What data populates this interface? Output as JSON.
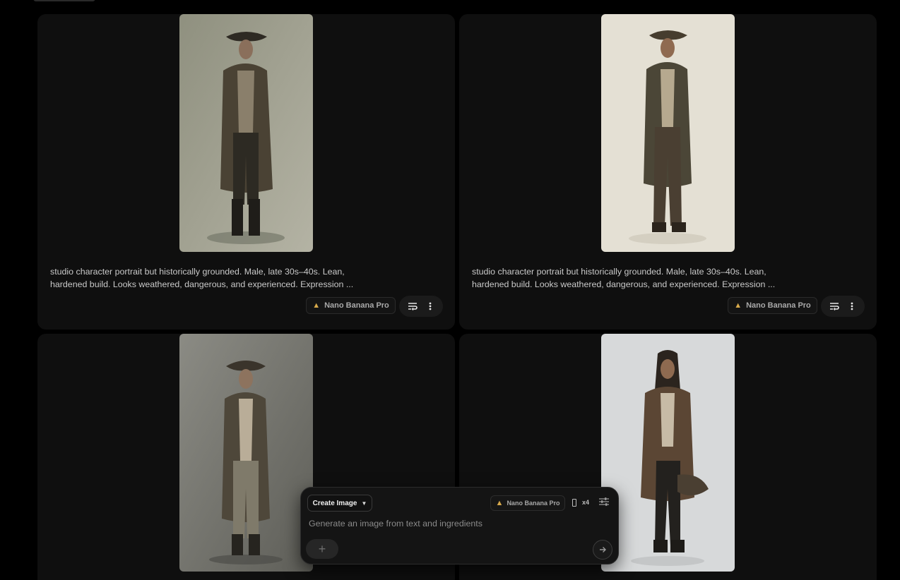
{
  "cards": [
    {
      "description_lines": [
        "studio character portrait but historically grounded. Male, late 30s–40s. Lean,",
        "hardened build. Looks weathered, dangerous, and experienced. Expression ..."
      ],
      "model_label": "Nano Banana Pro",
      "image_alt": "pirate figure in long weathered coat and tricorn hat, grey backdrop"
    },
    {
      "description_lines": [
        "studio character portrait but historically grounded. Male, late 30s–40s. Lean,",
        "hardened build. Looks weathered, dangerous, and experienced. Expression ..."
      ],
      "model_label": "Nano Banana Pro",
      "image_alt": "pirate figure in long weathered coat and tricorn hat, cream backdrop"
    },
    {
      "image_alt": "pirate figure in long coat and tricorn hat, dark grey backdrop"
    },
    {
      "image_alt": "long-haired pirate holding hat, light grey backdrop"
    }
  ],
  "composer": {
    "mode_label": "Create Image",
    "model_label": "Nano Banana Pro",
    "count_label": "x4",
    "placeholder": "Generate an image from text and ingredients",
    "add_label": "+"
  },
  "icons": {
    "model": "banana-icon",
    "prompt_toggle": "wrap-text-icon",
    "more": "more-vertical-icon",
    "aspect": "portrait-aspect-icon",
    "settings": "tune-icon",
    "send": "arrow-right-icon"
  },
  "colors": {
    "background": "#000000",
    "card": "#0f0f0f",
    "accent_banana": "#d7a94b"
  }
}
